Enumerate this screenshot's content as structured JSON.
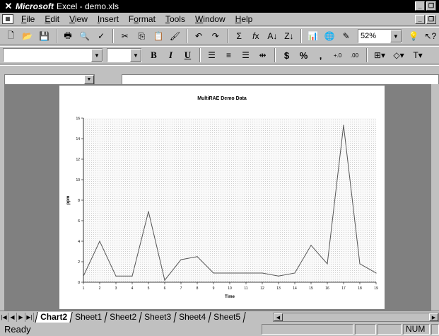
{
  "window": {
    "brand": "Microsoft",
    "title": "Excel - demo.xls",
    "app_icon": "excel-x-icon"
  },
  "menu": [
    {
      "label": "File",
      "u": "F"
    },
    {
      "label": "Edit",
      "u": "E"
    },
    {
      "label": "View",
      "u": "V"
    },
    {
      "label": "Insert",
      "u": "I"
    },
    {
      "label": "Format",
      "u": "o"
    },
    {
      "label": "Tools",
      "u": "T"
    },
    {
      "label": "Window",
      "u": "W"
    },
    {
      "label": "Help",
      "u": "H"
    }
  ],
  "toolbar": {
    "zoom": "52%"
  },
  "format_toolbar": {
    "bold": "B",
    "italic": "I",
    "underline": "U",
    "currency": "$",
    "percent": "%",
    "comma": ","
  },
  "chart_data": {
    "type": "line",
    "title": "MultiRAE Demo Data",
    "xlabel": "Time",
    "ylabel": "ppm",
    "x": [
      1,
      2,
      3,
      4,
      5,
      6,
      7,
      8,
      9,
      10,
      11,
      12,
      13,
      14,
      15,
      16,
      17,
      18,
      19
    ],
    "series": [
      {
        "values": [
          0.6,
          4.0,
          0.6,
          0.6,
          6.9,
          0.2,
          2.2,
          2.5,
          0.9,
          0.9,
          0.9,
          0.9,
          0.6,
          0.9,
          3.6,
          1.8,
          15.3,
          1.8,
          0.9
        ]
      }
    ],
    "ylim": [
      0,
      16
    ],
    "yticks": [
      0,
      2,
      4,
      6,
      8,
      10,
      12,
      14,
      16
    ],
    "grid": false,
    "legend": "none"
  },
  "sheets": [
    "Chart2",
    "Sheet1",
    "Sheet2",
    "Sheet3",
    "Sheet4",
    "Sheet5"
  ],
  "active_sheet": "Chart2",
  "status": {
    "text": "Ready",
    "num": "NUM"
  }
}
